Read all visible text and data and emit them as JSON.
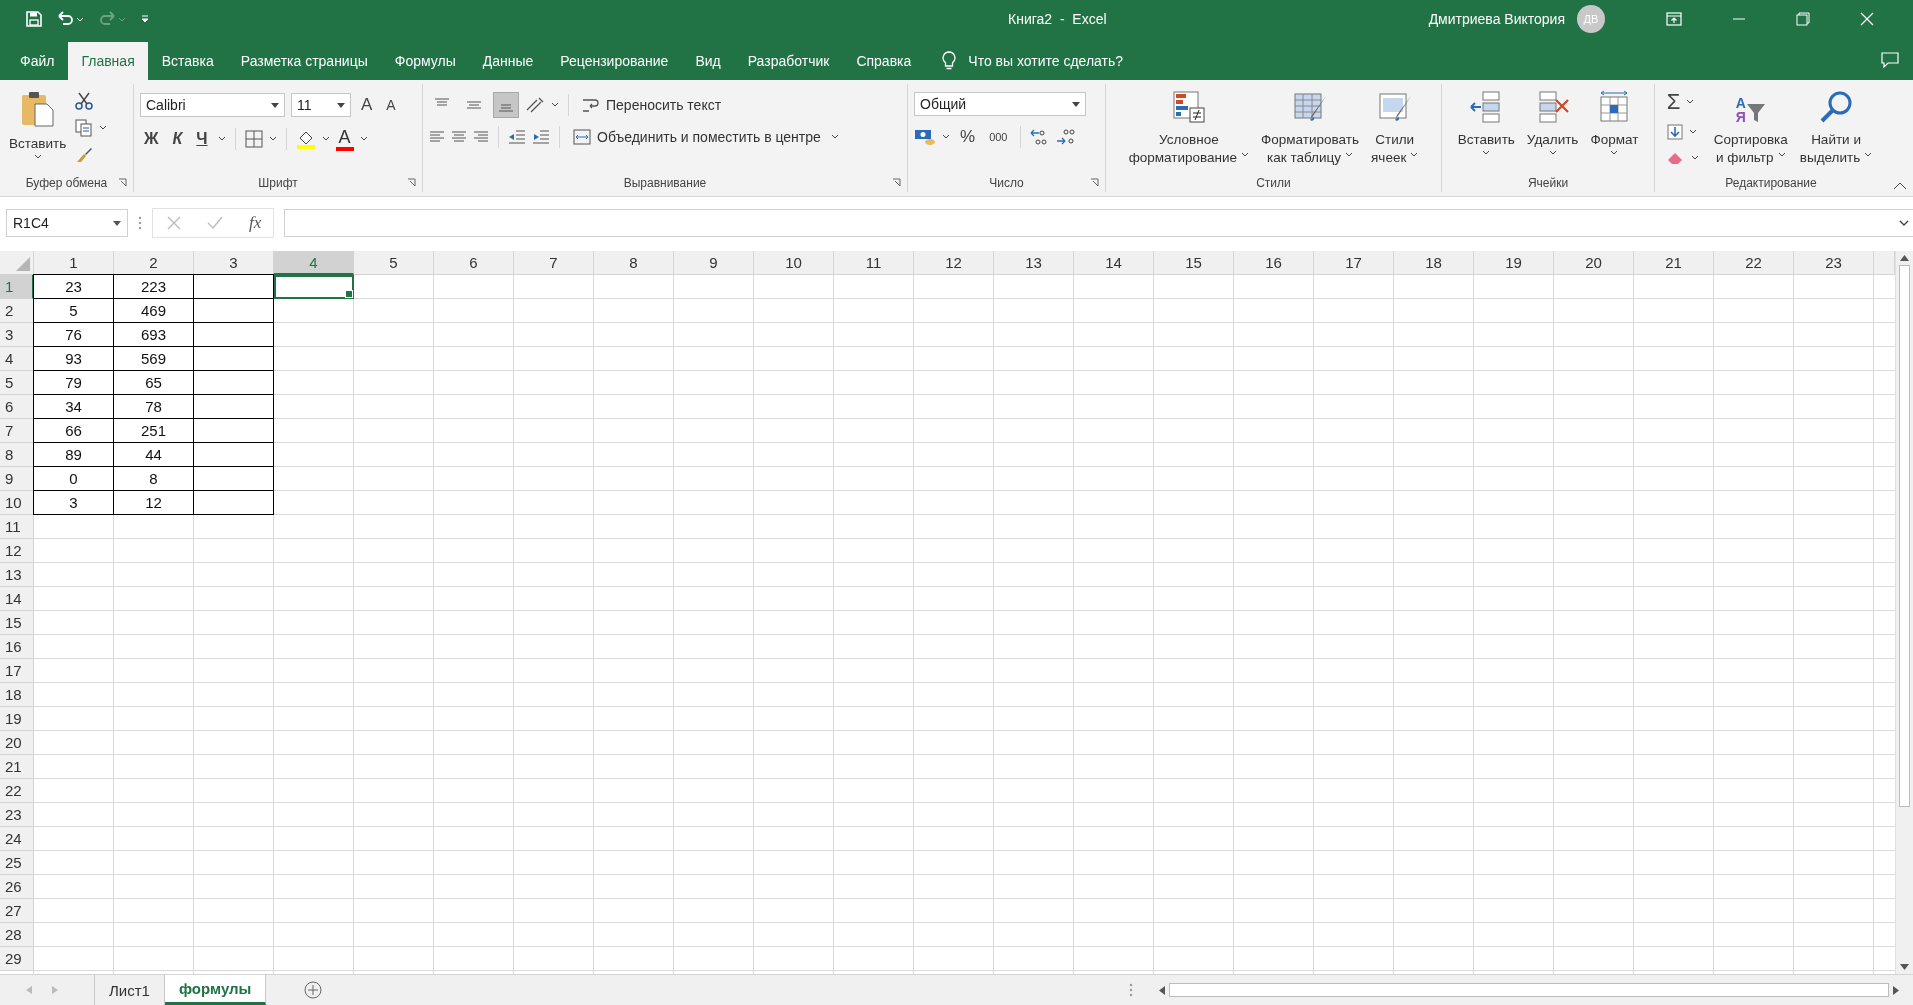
{
  "window": {
    "title": "Книга2  -  Excel",
    "user": "Дмитриева Виктория",
    "avatar": "ДВ"
  },
  "tabs": [
    {
      "label": "Файл",
      "selected": false
    },
    {
      "label": "Главная",
      "selected": true
    },
    {
      "label": "Вставка",
      "selected": false
    },
    {
      "label": "Разметка страницы",
      "selected": false
    },
    {
      "label": "Формулы",
      "selected": false
    },
    {
      "label": "Данные",
      "selected": false
    },
    {
      "label": "Рецензирование",
      "selected": false
    },
    {
      "label": "Вид",
      "selected": false
    },
    {
      "label": "Разработчик",
      "selected": false
    },
    {
      "label": "Справка",
      "selected": false
    }
  ],
  "tell_me": {
    "placeholder": "Что вы хотите сделать?"
  },
  "ribbon": {
    "clipboard": {
      "paste": "Вставить",
      "group": "Буфер обмена"
    },
    "font": {
      "name": "Calibri",
      "size": "11",
      "grow": "A",
      "shrink": "A",
      "bold": "Ж",
      "italic": "К",
      "underline": "Ч",
      "color_letter": "A",
      "group": "Шрифт"
    },
    "alignment": {
      "vertical": [
        {
          "selected": false
        },
        {
          "selected": false
        },
        {
          "selected": true
        }
      ],
      "wrap": "Переносить текст",
      "merge": "Объединить и поместить в центре",
      "group": "Выравнивание"
    },
    "number": {
      "format": "Общий",
      "percent": "%",
      "thousands": "000",
      "group": "Число"
    },
    "styles": {
      "buttons": [
        {
          "lines": [
            "Условное",
            "форматирование"
          ]
        },
        {
          "lines": [
            "Форматировать",
            "как таблицу"
          ]
        },
        {
          "lines": [
            "Стили",
            "ячеек"
          ]
        }
      ],
      "group": "Стили"
    },
    "cells": {
      "buttons": [
        "Вставить",
        "Удалить",
        "Формат"
      ],
      "group": "Ячейки"
    },
    "editing": {
      "sum": "Σ",
      "sort_letters": [
        "А",
        "Я"
      ],
      "buttons": [
        {
          "lines": [
            "Сортировка",
            "и фильтр"
          ]
        },
        {
          "lines": [
            "Найти и",
            "выделить"
          ]
        }
      ],
      "group": "Редактирование"
    }
  },
  "formula_bar": {
    "name_box": "R1C4",
    "fx": "fx"
  },
  "columns": [
    {
      "label": "1",
      "selected": false,
      "bordered": true
    },
    {
      "label": "2",
      "selected": false,
      "bordered": true
    },
    {
      "label": "3",
      "selected": false,
      "bordered": true
    },
    {
      "label": "4",
      "selected": true
    },
    {
      "label": "5",
      "selected": false
    },
    {
      "label": "6",
      "selected": false
    },
    {
      "label": "7",
      "selected": false
    },
    {
      "label": "8",
      "selected": false
    },
    {
      "label": "9",
      "selected": false
    },
    {
      "label": "10",
      "selected": false
    },
    {
      "label": "11",
      "selected": false
    },
    {
      "label": "12",
      "selected": false
    },
    {
      "label": "13",
      "selected": false
    },
    {
      "label": "14",
      "selected": false
    },
    {
      "label": "15",
      "selected": false
    },
    {
      "label": "16",
      "selected": false
    },
    {
      "label": "17",
      "selected": false
    },
    {
      "label": "18",
      "selected": false
    },
    {
      "label": "19",
      "selected": false
    },
    {
      "label": "20",
      "selected": false
    },
    {
      "label": "21",
      "selected": false
    },
    {
      "label": "22",
      "selected": false
    },
    {
      "label": "23",
      "selected": false
    }
  ],
  "rows": [
    {
      "label": "1",
      "selected": true,
      "bordered": true,
      "cells": [
        "23",
        "223"
      ]
    },
    {
      "label": "2",
      "selected": false,
      "bordered": true,
      "cells": [
        "5",
        "469"
      ]
    },
    {
      "label": "3",
      "selected": false,
      "bordered": true,
      "cells": [
        "76",
        "693"
      ]
    },
    {
      "label": "4",
      "selected": false,
      "bordered": true,
      "cells": [
        "93",
        "569"
      ]
    },
    {
      "label": "5",
      "selected": false,
      "bordered": true,
      "cells": [
        "79",
        "65"
      ]
    },
    {
      "label": "6",
      "selected": false,
      "bordered": true,
      "cells": [
        "34",
        "78"
      ]
    },
    {
      "label": "7",
      "selected": false,
      "bordered": true,
      "cells": [
        "66",
        "251"
      ]
    },
    {
      "label": "8",
      "selected": false,
      "bordered": true,
      "cells": [
        "89",
        "44"
      ]
    },
    {
      "label": "9",
      "selected": false,
      "bordered": true,
      "cells": [
        "0",
        "8"
      ]
    },
    {
      "label": "10",
      "selected": false,
      "bordered": true,
      "cells": [
        "3",
        "12"
      ]
    },
    {
      "label": "11",
      "selected": false
    },
    {
      "label": "12",
      "selected": false
    },
    {
      "label": "13",
      "selected": false
    },
    {
      "label": "14",
      "selected": false
    },
    {
      "label": "15",
      "selected": false
    },
    {
      "label": "16",
      "selected": false
    },
    {
      "label": "17",
      "selected": false
    },
    {
      "label": "18",
      "selected": false
    },
    {
      "label": "19",
      "selected": false
    },
    {
      "label": "20",
      "selected": false
    },
    {
      "label": "21",
      "selected": false
    },
    {
      "label": "22",
      "selected": false
    },
    {
      "label": "23",
      "selected": false
    },
    {
      "label": "24",
      "selected": false
    },
    {
      "label": "25",
      "selected": false
    },
    {
      "label": "26",
      "selected": false
    },
    {
      "label": "27",
      "selected": false
    },
    {
      "label": "28",
      "selected": false
    },
    {
      "label": "29",
      "selected": false
    }
  ],
  "sheets": [
    {
      "label": "Лист1",
      "selected": false
    },
    {
      "label": "формулы",
      "selected": true
    }
  ]
}
